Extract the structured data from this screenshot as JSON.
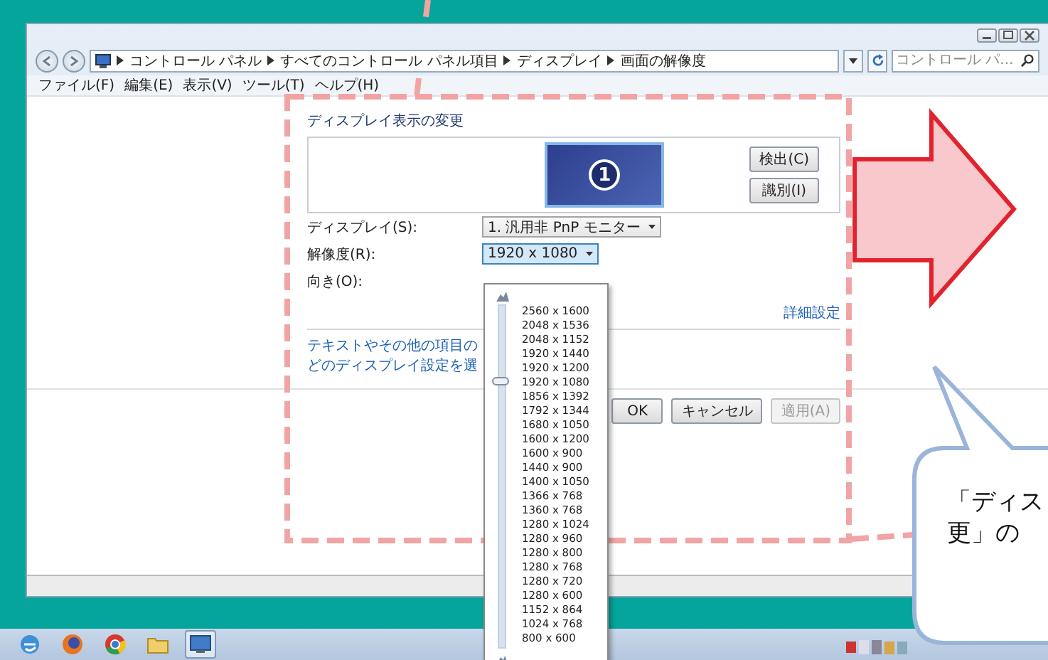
{
  "address_bar": {
    "breadcrumb": [
      "コントロール パネル",
      "すべてのコントロール パネル項目",
      "ディスプレイ",
      "画面の解像度"
    ]
  },
  "search": {
    "placeholder": "コントロール パ..."
  },
  "menu": [
    "ファイル(F)",
    "編集(E)",
    "表示(V)",
    "ツール(T)",
    "ヘルプ(H)"
  ],
  "heading": "ディスプレイ表示の変更",
  "monitor": {
    "number": "1"
  },
  "side_buttons": [
    "検出(C)",
    "識別(I)"
  ],
  "fields": [
    {
      "label": "ディスプレイ(S):",
      "value": "1. 汎用非 PnP モニター",
      "open": false
    },
    {
      "label": "解像度(R):",
      "value": "1920 x 1080",
      "open": true
    },
    {
      "label": "向き(O):"
    }
  ],
  "advanced_link": "詳細設定",
  "links": [
    "テキストやその他の項目の",
    "どのディスプレイ設定を選"
  ],
  "buttons": [
    {
      "label": "OK",
      "disabled": false
    },
    {
      "label": "キャンセル",
      "disabled": false
    },
    {
      "label": "適用(A)",
      "disabled": true
    }
  ],
  "resolution_list": {
    "items": [
      "2560 x 1600",
      "2048 x 1536",
      "2048 x 1152",
      "1920 x 1440",
      "1920 x 1200",
      "1920 x 1080",
      "1856 x 1392",
      "1792 x 1344",
      "1680 x 1050",
      "1600 x 1200",
      "1600 x 900",
      "1440 x 900",
      "1400 x 1050",
      "1366 x 768",
      "1360 x 768",
      "1280 x 1024",
      "1280 x 960",
      "1280 x 800",
      "1280 x 768",
      "1280 x 720",
      "1280 x 600",
      "1152 x 864",
      "1024 x 768",
      "800 x 600"
    ],
    "level": 0.78
  },
  "taskbar": {
    "items": [
      {
        "kind": "ie",
        "selected": false
      },
      {
        "kind": "firefox",
        "selected": false
      },
      {
        "kind": "chrome",
        "selected": false
      },
      {
        "kind": "folder",
        "selected": false
      },
      {
        "kind": "display",
        "selected": true
      }
    ]
  },
  "callout": {
    "lines": [
      "「ディス",
      "更」の"
    ]
  }
}
